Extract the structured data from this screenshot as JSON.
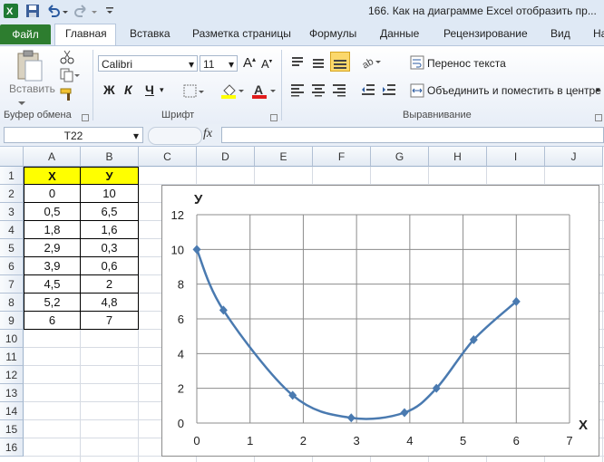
{
  "window": {
    "title": "166. Как на диаграмме Excel отобразить пр..."
  },
  "tabs": [
    "Файл",
    "Главная",
    "Вставка",
    "Разметка страницы",
    "Формулы",
    "Данные",
    "Рецензирование",
    "Вид",
    "На"
  ],
  "ribbon": {
    "paste_label": "Вставить",
    "font_name": "Calibri",
    "font_size": "11",
    "bold": "Ж",
    "italic": "К",
    "underline": "Ч",
    "wrap_text": "Перенос текста",
    "merge_center": "Объединить и поместить в центре",
    "groups": [
      "Буфер обмена",
      "Шрифт",
      "Выравнивание"
    ]
  },
  "formula_bar": {
    "name_box": "T22",
    "fx": "fx",
    "value": ""
  },
  "sheet": {
    "columns": [
      "A",
      "B",
      "C",
      "D",
      "E",
      "F",
      "G",
      "H",
      "I",
      "J"
    ],
    "rows": [
      "1",
      "2",
      "3",
      "4",
      "5",
      "6",
      "7",
      "8",
      "9",
      "10",
      "11",
      "12",
      "13",
      "14",
      "15",
      "16"
    ],
    "header": [
      "Х",
      "У"
    ],
    "data": [
      [
        "0",
        "10"
      ],
      [
        "0,5",
        "6,5"
      ],
      [
        "1,8",
        "1,6"
      ],
      [
        "2,9",
        "0,3"
      ],
      [
        "3,9",
        "0,6"
      ],
      [
        "4,5",
        "2"
      ],
      [
        "5,2",
        "4,8"
      ],
      [
        "6",
        "7"
      ]
    ],
    "header_fill": "#ffff00"
  },
  "chart_data": {
    "type": "scatter",
    "smooth": true,
    "markers": "diamond",
    "color": "#4a7ab0",
    "x": [
      0,
      0.5,
      1.8,
      2.9,
      3.9,
      4.5,
      5.2,
      6
    ],
    "y": [
      10,
      6.5,
      1.6,
      0.3,
      0.6,
      2,
      4.8,
      7
    ],
    "xlabel": "Х",
    "ylabel": "У",
    "xlim": [
      0,
      7
    ],
    "ylim": [
      0,
      12
    ],
    "x_ticks": [
      "0",
      "1",
      "2",
      "3",
      "4",
      "5",
      "6",
      "7"
    ],
    "y_ticks": [
      "0",
      "2",
      "4",
      "6",
      "8",
      "10",
      "12"
    ],
    "grid": true,
    "legend": "none"
  }
}
